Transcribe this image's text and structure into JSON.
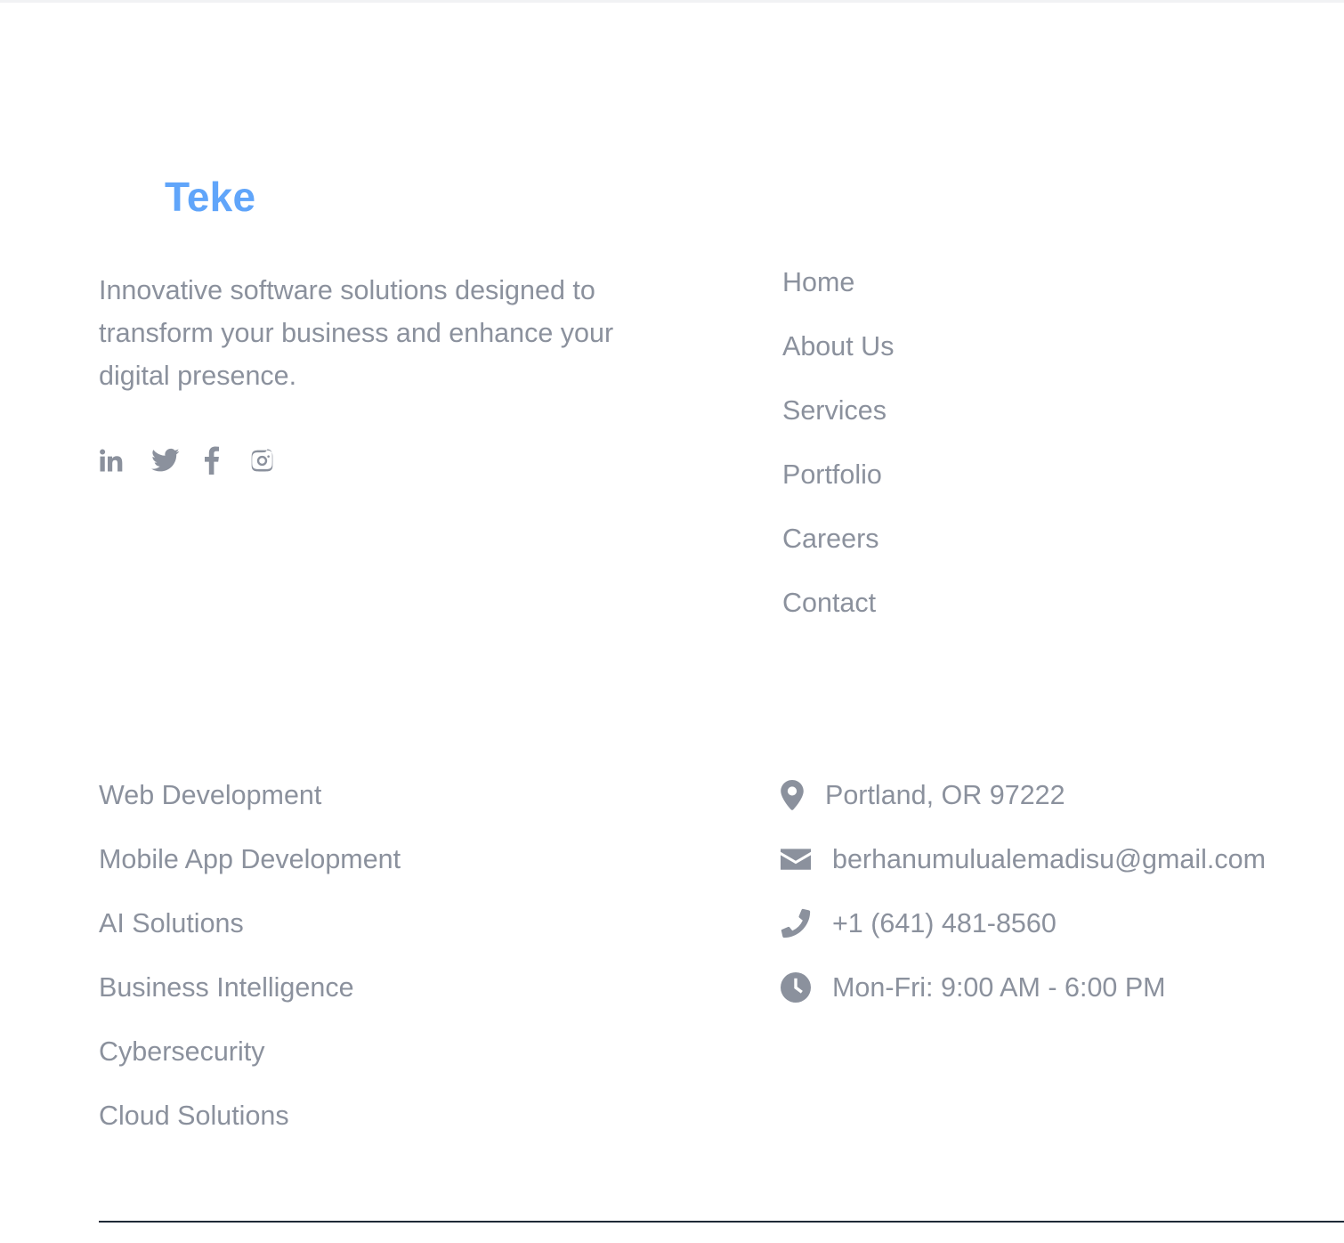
{
  "brand": {
    "name": "Teke",
    "color": "#60a5fa"
  },
  "about": {
    "tagline": "Innovative software solutions designed to transform your business and enhance your digital presence.",
    "social": [
      {
        "icon": "linkedin-icon",
        "label": "LinkedIn"
      },
      {
        "icon": "twitter-icon",
        "label": "Twitter"
      },
      {
        "icon": "facebook-icon",
        "label": "Facebook"
      },
      {
        "icon": "instagram-icon",
        "label": "Instagram"
      }
    ]
  },
  "quick_links": [
    {
      "label": "Home"
    },
    {
      "label": "About Us"
    },
    {
      "label": "Services"
    },
    {
      "label": "Portfolio"
    },
    {
      "label": "Careers"
    },
    {
      "label": "Contact"
    }
  ],
  "services": [
    {
      "label": "Web Development"
    },
    {
      "label": "Mobile App Development"
    },
    {
      "label": "AI Solutions"
    },
    {
      "label": "Business Intelligence"
    },
    {
      "label": "Cybersecurity"
    },
    {
      "label": "Cloud Solutions"
    }
  ],
  "contact": {
    "address": {
      "icon": "map-pin-icon",
      "text": "Portland, OR 97222"
    },
    "email": {
      "icon": "envelope-icon",
      "text": "berhanumulualemadisu@gmail.com"
    },
    "phone": {
      "icon": "phone-icon",
      "text": "+1 (641) 481-8560"
    },
    "hours": {
      "icon": "clock-icon",
      "text": "Mon-Fri: 9:00 AM - 6:00 PM"
    }
  },
  "colors": {
    "text_muted": "#8b919d",
    "divider": "#1f2937",
    "background": "#ffffff"
  }
}
